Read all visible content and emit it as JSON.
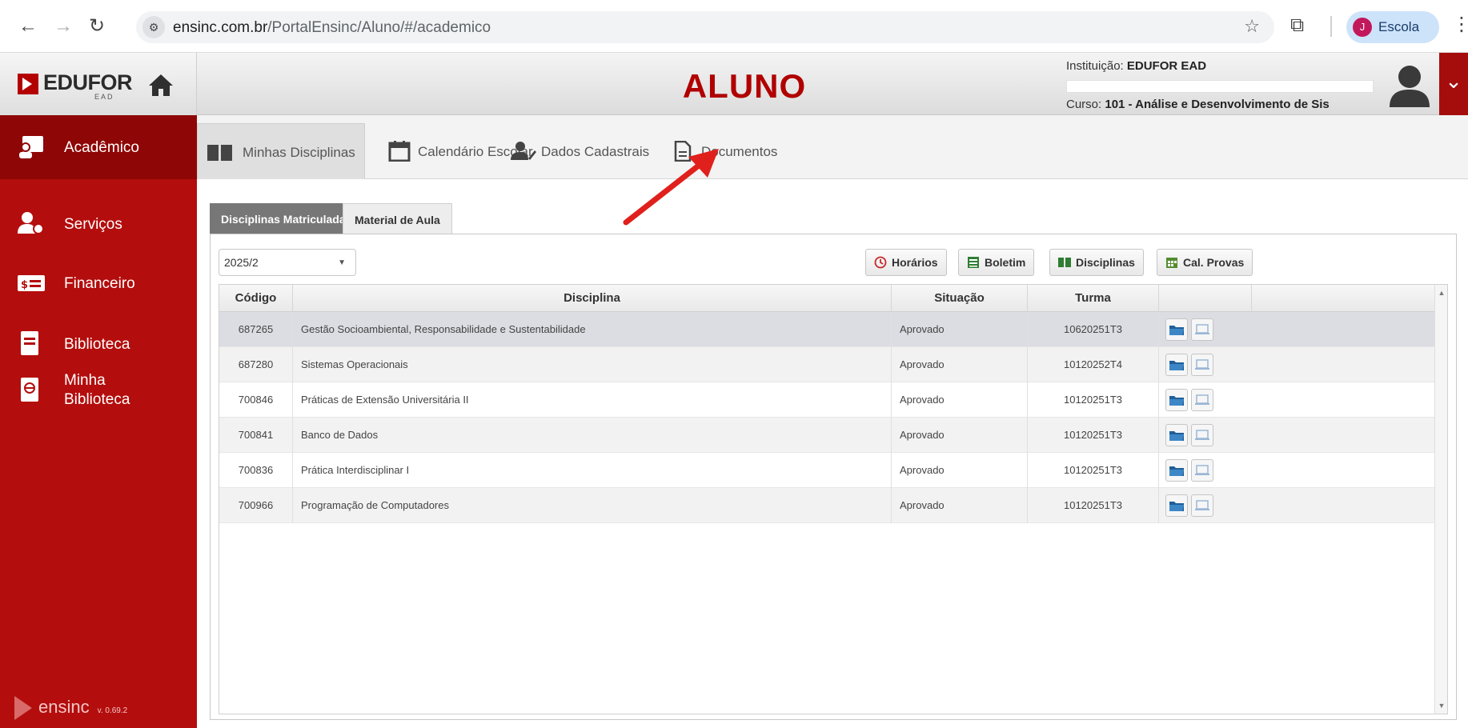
{
  "browser": {
    "url_host": "ensinc.com.br",
    "url_path": "/PortalEnsinc/Aluno/#/academico",
    "profile_initial": "J",
    "profile_label": "Escola"
  },
  "header": {
    "logo_text": "EDUFOR",
    "logo_sub": "EAD",
    "title": "ALUNO",
    "institution_label": "Instituição:",
    "institution_value": "EDUFOR EAD",
    "course_label": "Curso:",
    "course_value": "101 - Análise e Desenvolvimento de Sis"
  },
  "sidebar": {
    "items": [
      {
        "label": "Acadêmico",
        "icon": "academic-icon",
        "active": true
      },
      {
        "label": "Serviços",
        "icon": "services-icon",
        "active": false
      },
      {
        "label": "Financeiro",
        "icon": "finance-icon",
        "active": false
      },
      {
        "label": "Biblioteca",
        "icon": "library-icon",
        "active": false
      },
      {
        "label_line1": "Minha",
        "label_line2": "Biblioteca",
        "icon": "my-library-icon",
        "active": false
      }
    ],
    "brand": "ensinc",
    "version": "v. 0.69.2"
  },
  "tabs": [
    {
      "label": "Minhas Disciplinas",
      "icon": "book-icon"
    },
    {
      "label": "Calendário Escolar",
      "icon": "calendar-icon"
    },
    {
      "label": "Dados Cadastrais",
      "icon": "user-edit-icon"
    },
    {
      "label": "Documentos",
      "icon": "document-icon"
    }
  ],
  "subtabs": {
    "enrolled": "Disciplinas Matriculadas",
    "material": "Material de Aula"
  },
  "term_select": {
    "value": "2025/2"
  },
  "actions": {
    "horarios": "Horários",
    "boletim": "Boletim",
    "disciplinas": "Disciplinas",
    "cal_provas": "Cal. Provas"
  },
  "table": {
    "headers": {
      "code": "Código",
      "discipline": "Disciplina",
      "status": "Situação",
      "class": "Turma"
    },
    "rows": [
      {
        "code": "687265",
        "discipline": "Gestão Socioambiental, Responsabilidade e Sustentabilidade",
        "status": "Aprovado",
        "class": "10620251T3"
      },
      {
        "code": "687280",
        "discipline": "Sistemas Operacionais",
        "status": "Aprovado",
        "class": "10120252T4"
      },
      {
        "code": "700846",
        "discipline": "Práticas de Extensão Universitária II",
        "status": "Aprovado",
        "class": "10120251T3"
      },
      {
        "code": "700841",
        "discipline": "Banco de Dados",
        "status": "Aprovado",
        "class": "10120251T3"
      },
      {
        "code": "700836",
        "discipline": "Prática Interdisciplinar I",
        "status": "Aprovado",
        "class": "10120251T3"
      },
      {
        "code": "700966",
        "discipline": "Programação de Computadores",
        "status": "Aprovado",
        "class": "10120251T3"
      }
    ]
  },
  "colors": {
    "brand_red": "#b40d0d",
    "title_red": "#b00000",
    "annotation_arrow": "#e0201c"
  }
}
